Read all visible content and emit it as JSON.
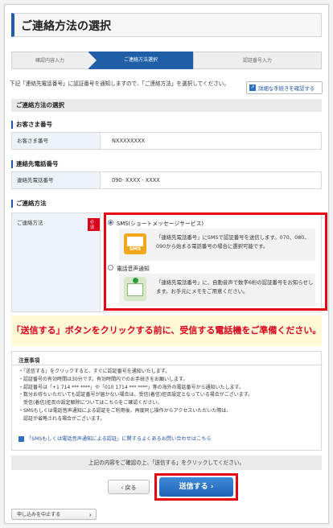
{
  "page_title": "ご連絡方法の選択",
  "steps": [
    "確認内容入力",
    "ご連絡方法選択",
    "認証番号入力"
  ],
  "intro_text": "下記「連絡先電話番号」に認証番号を通知しますので、「ご連絡方法」を選択してください。",
  "guide_link": "詳細な手続きを確認する",
  "section_title": "ご連絡方法の選択",
  "customer": {
    "heading": "お客さま番号",
    "label": "お客さま番号",
    "value": "NXXXXXXXX"
  },
  "phone": {
    "heading": "連絡先電話番号",
    "label": "連絡先電話番号",
    "value": "090- XXXX - XXXX"
  },
  "method": {
    "heading": "ご連絡方法",
    "label": "ご連絡方法",
    "required": "必須",
    "options": [
      {
        "label": "SMS(ショートメッセージサービス)",
        "desc": "「連絡先電話番号」にSMSで認証番号を送信します。070、080、090から始まる電話番号の場合に選択可能です。",
        "icon": "sms-icon",
        "icon_text": "SMS",
        "selected": true
      },
      {
        "label": "電話音声通知",
        "desc": "「連絡先電話番号」に、自動音声で数字6桁の認証番号をお知らせします。お手元にメモをご用意ください。",
        "icon": "telephone-icon",
        "selected": false
      }
    ]
  },
  "notice": "「送信する」ボタンをクリックする前に、受信する電話機をご準備ください。",
  "notes": {
    "title": "注意事項",
    "items": [
      "・「送信する」をクリックすると、すぐに認証番号を通知いたします。",
      "・認証番号の有効時間は30分です。有効時間内でのお手続きをお願いします。",
      "・認証番号は「+1 714 *** ****」や「010 1714 *** ****」等の海外の電話番号から通知いたします。",
      "・数分お待ちいただいても認証番号が届かない場合は、受信(着信)拒否設定となっている場合がございます。",
      "　受信(着信)拒否の設定解除についてはこちらをご確認ください。",
      "・SMSもしくは電話音声通知による認証をご利用後、再度同じ操作からアクセスいただいた際は、",
      "　認証が省略される場合がございます。"
    ],
    "link": "「SMSもしくは電話音声通知による認証」に関するよくあるお問い合わせはこちら"
  },
  "confirm_text": "上記の内容をご確認の上、「送信する」をクリックしてください。",
  "buttons": {
    "back": "‹ 戻る",
    "send": "送信する ›",
    "cancel": "申し込みを中止する"
  },
  "colors": {
    "accent": "#1f5fa8",
    "highlight": "#e60012",
    "notice_bg": "#fff9d6"
  }
}
